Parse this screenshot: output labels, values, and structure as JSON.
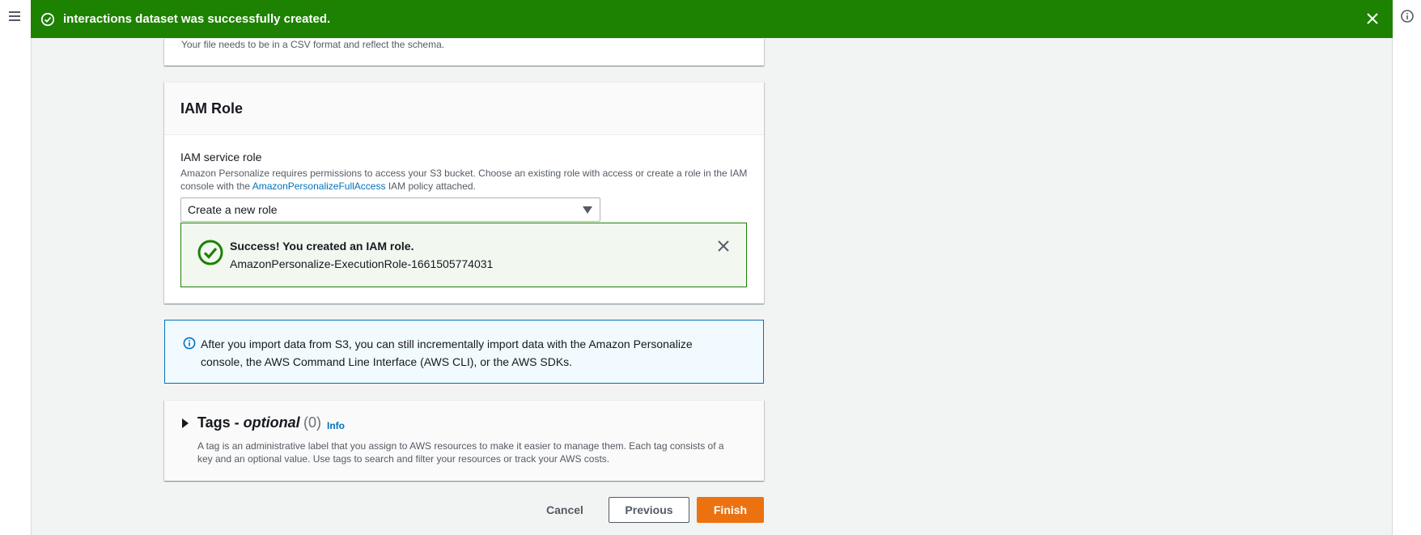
{
  "flash": {
    "message": "interactions dataset was successfully created."
  },
  "upload_card": {
    "note": "Your file needs to be in a CSV format and reflect the schema."
  },
  "iam_role": {
    "heading": "IAM Role",
    "field_label": "IAM service role",
    "desc_part1": "Amazon Personalize requires permissions to access your S3 bucket. Choose an existing role with access or create a role in the IAM console with the ",
    "desc_link": "AmazonPersonalizeFullAccess",
    "desc_part2": " IAM policy attached.",
    "select_value": "Create a new role",
    "success_title": "Success! You created an IAM role.",
    "success_detail": "AmazonPersonalize-ExecutionRole-1661505774031"
  },
  "info_alert": {
    "text": "After you import data from S3, you can still incrementally import data with the Amazon Personalize console, the AWS Command Line Interface (AWS CLI), or the AWS SDKs."
  },
  "tags": {
    "title_main": "Tags - ",
    "title_optional": "optional",
    "count": "(0)",
    "info_link": "Info",
    "description": "A tag is an administrative label that you assign to AWS resources to make it easier to manage them. Each tag consists of a key and an optional value. Use tags to search and filter your resources or track your AWS costs."
  },
  "actions": {
    "cancel_label": "Cancel",
    "previous_label": "Previous",
    "finish_label": "Finish"
  },
  "colors": {
    "flash_success": "#1d8102",
    "primary_button": "#ec7211",
    "link": "#0073bb"
  }
}
